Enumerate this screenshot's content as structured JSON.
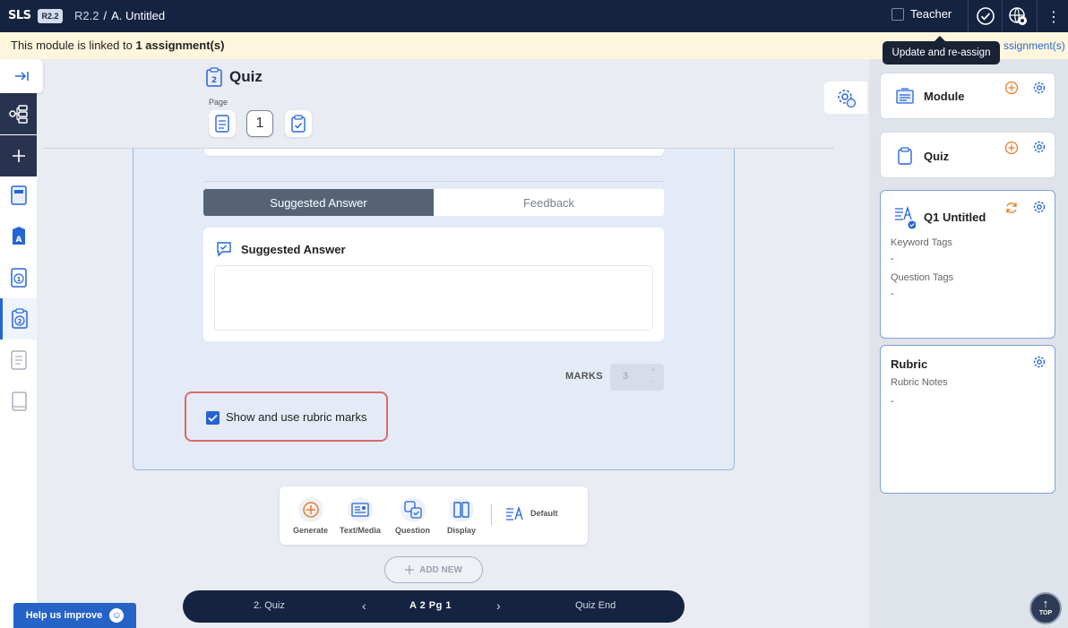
{
  "topbar": {
    "logo": "SLS",
    "version": "R2.2",
    "breadcrumb": {
      "version": "R2.2",
      "separator": "/",
      "title": "A. Untitled"
    },
    "user_role": "Teacher",
    "menu_icon": "⋮"
  },
  "banner": {
    "prefix": "This module is linked to ",
    "count_text": "1 assignment(s)",
    "link_text": "ssignment(s)"
  },
  "tooltip": {
    "text": "Update and re-assign"
  },
  "quiz_header": {
    "title": "Quiz",
    "page_label": "Page",
    "page_number": "1"
  },
  "answer_tabs": [
    {
      "label": "Suggested Answer",
      "active": true
    },
    {
      "label": "Feedback",
      "active": false
    }
  ],
  "suggested_answer": {
    "title": "Suggested Answer",
    "value": ""
  },
  "marks": {
    "label": "MARKS",
    "value": "3"
  },
  "rubric_checkbox": {
    "label": "Show and use rubric marks",
    "checked": true
  },
  "toolbar": {
    "items": [
      {
        "label": "Generate",
        "icon": "sparkle-plus-icon"
      },
      {
        "label": "Text/Media",
        "icon": "text-media-icon"
      },
      {
        "label": "Question",
        "icon": "question-icon"
      },
      {
        "label": "Display",
        "icon": "display-columns-icon"
      }
    ],
    "default_label": "Default"
  },
  "add_new": {
    "label": "ADD NEW"
  },
  "bottom_nav": {
    "prev": "2. Quiz",
    "position": "A  2  Pg 1",
    "next": "Quiz End"
  },
  "help": {
    "label": "Help us improve"
  },
  "right_panel": {
    "module": {
      "title": "Module"
    },
    "quiz": {
      "title": "Quiz"
    },
    "question": {
      "title": "Q1 Untitled",
      "keyword_tags_label": "Keyword Tags",
      "keyword_tags_value": "-",
      "question_tags_label": "Question Tags",
      "question_tags_value": "-"
    },
    "rubric": {
      "title": "Rubric",
      "notes_label": "Rubric Notes",
      "notes_value": "-"
    }
  },
  "top_button": {
    "label": "TOP"
  },
  "colors": {
    "navy": "#142340",
    "accent_blue": "#2563d0",
    "orange": "#f07c2a",
    "highlight_red": "#d96a6a",
    "banner": "#fff6dd"
  }
}
